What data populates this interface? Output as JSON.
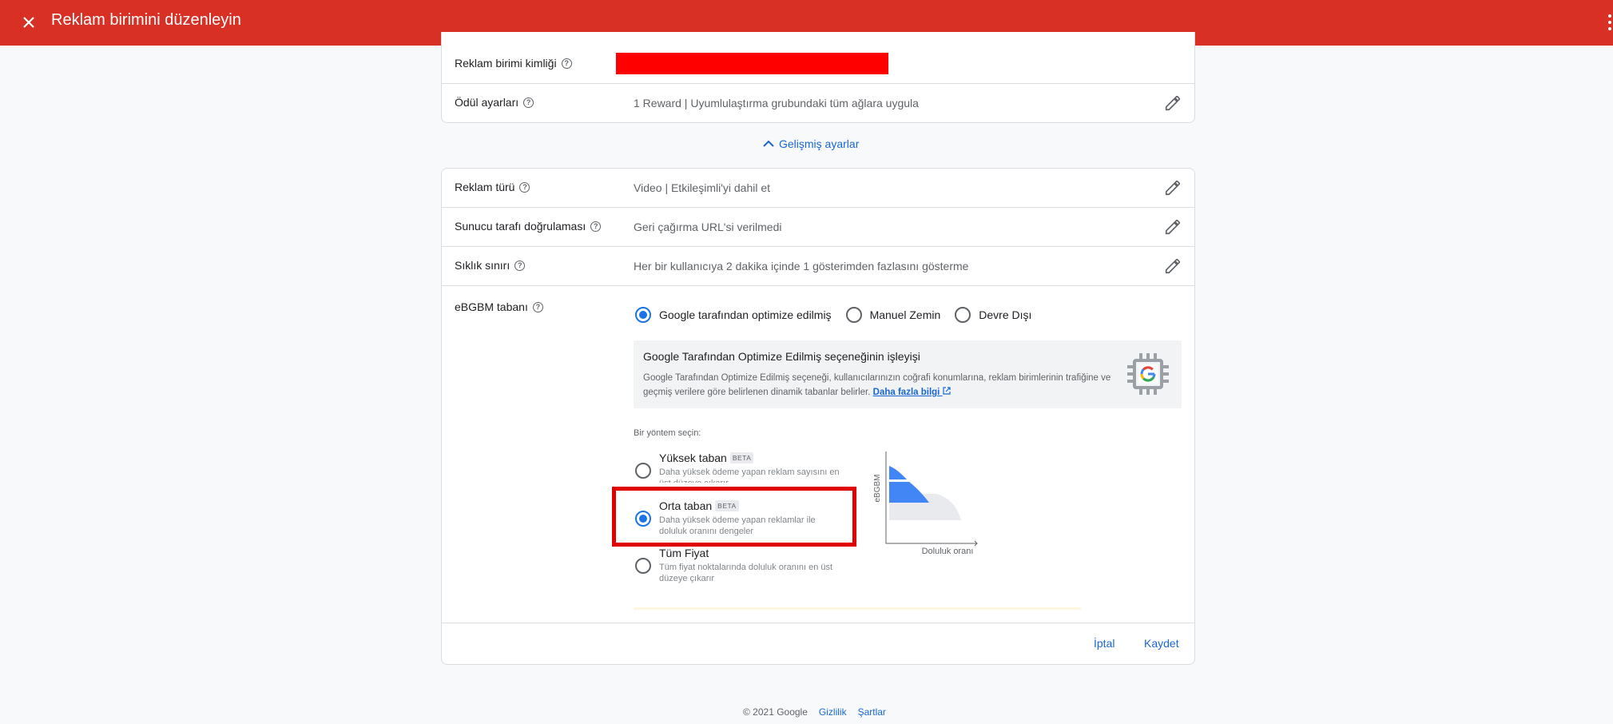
{
  "topbar": {
    "title": "Reklam birimini düzenleyin",
    "close_icon": "close-icon",
    "menu_icon": "more-vert-icon",
    "color": "#d93025"
  },
  "fields": {
    "ad_unit_id_label": "Reklam birimi kimliği",
    "reward_label": "Ödül ayarları",
    "reward_value": "1 Reward | Uyumlulaştırma grubundaki tüm ağlara uygula"
  },
  "advanced": {
    "label": "Gelişmiş ayarlar"
  },
  "advanced_fields": {
    "ad_type_label": "Reklam türü",
    "ad_type_value": "Video | Etkileşimli'yi dahil et",
    "ssv_label": "Sunucu tarafı doğrulaması",
    "ssv_value": "Geri çağırma URL'si verilmedi",
    "freq_label": "Sıklık sınırı",
    "freq_value": "Her bir kullanıcıya 2 dakika içinde 1 gösterimden fazlasını gösterme",
    "ecpm_label": "eBGBM tabanı"
  },
  "ecpm_modes": {
    "google": "Google tarafından optimize edilmiş",
    "manual": "Manuel Zemin",
    "disabled": "Devre Dışı",
    "selected": "google"
  },
  "info_box": {
    "title": "Google Tarafından Optimize Edilmiş seçeneğinin işleyişi",
    "text": "Google Tarafından Optimize Edilmiş seçeneği, kullanıcılarınızın coğrafi konumlarına, reklam birimlerinin trafiğine ve geçmiş verilere göre belirlenen dinamik tabanlar belirler.",
    "link": "Daha fazla bilgi"
  },
  "method": {
    "label": "Bir yöntem seçin:",
    "options": [
      {
        "title": "Yüksek taban",
        "badge": "BETA",
        "desc": "Daha yüksek ödeme yapan reklam sayısını en üst düzeye çıkarır"
      },
      {
        "title": "Orta taban",
        "badge": "BETA",
        "desc": "Daha yüksek ödeme yapan reklamlar ile doluluk oranını dengeler"
      },
      {
        "title": "Tüm Fiyat",
        "badge": "",
        "desc": "Tüm fiyat noktalarında doluluk oranını en üst düzeye çıkarır"
      }
    ],
    "selected": 1
  },
  "chart": {
    "ylabel": "eBGBM",
    "xlabel": "Doluluk oranı",
    "fill_color": "#4285f4"
  },
  "actions": {
    "cancel": "İptal",
    "save": "Kaydet"
  },
  "footer": {
    "copyright": "© 2021 Google",
    "privacy": "Gizlilik",
    "terms": "Şartlar"
  }
}
